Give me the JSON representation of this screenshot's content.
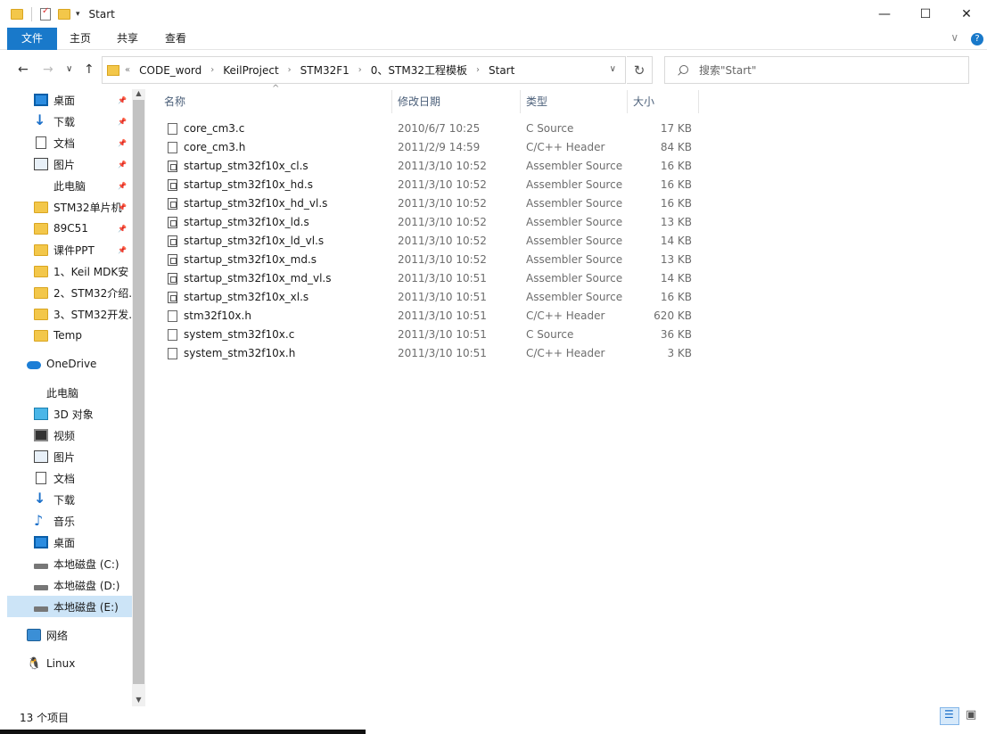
{
  "window": {
    "title": "Start",
    "controls": [
      "—",
      "☐",
      "✕"
    ]
  },
  "ribbon": {
    "tabs": [
      "文件",
      "主页",
      "共享",
      "查看"
    ],
    "expand": "∨",
    "help": "?"
  },
  "nav": {
    "back": "←",
    "forward": "→",
    "recent": "∨",
    "up": "↑",
    "overflow": "«",
    "breadcrumbs": [
      "CODE_word",
      "KeilProject",
      "STM32F1",
      "0、STM32工程模板",
      "Start"
    ],
    "dropdown": "∨",
    "refresh": "↻",
    "search_placeholder": "搜索\"Start\""
  },
  "sidebar": {
    "items": [
      {
        "label": "桌面",
        "icon": "desktop-icon",
        "pinned": true
      },
      {
        "label": "下载",
        "icon": "download-icon",
        "pinned": true
      },
      {
        "label": "文档",
        "icon": "document-icon",
        "pinned": true
      },
      {
        "label": "图片",
        "icon": "pictures-icon",
        "pinned": true
      },
      {
        "label": "此电脑",
        "icon": "",
        "pinned": true
      },
      {
        "label": "STM32单片机",
        "icon": "folder-icon",
        "pinned": true
      },
      {
        "label": "89C51",
        "icon": "folder-icon",
        "pinned": true
      },
      {
        "label": "课件PPT",
        "icon": "folder-icon",
        "pinned": true
      },
      {
        "label": "1、Keil MDK安",
        "icon": "folder-icon",
        "pinned": false
      },
      {
        "label": "2、STM32介绍.",
        "icon": "folder-icon",
        "pinned": false
      },
      {
        "label": "3、STM32开发.",
        "icon": "folder-icon",
        "pinned": false
      },
      {
        "label": "Temp",
        "icon": "folder-icon",
        "pinned": false
      },
      {
        "label": "OneDrive",
        "icon": "onedrive-icon",
        "pinned": false
      },
      {
        "label": "此电脑",
        "icon": "",
        "pinned": false
      },
      {
        "label": "3D 对象",
        "icon": "3d-objects-icon",
        "pinned": false
      },
      {
        "label": "视频",
        "icon": "video-icon",
        "pinned": false
      },
      {
        "label": "图片",
        "icon": "pictures-icon",
        "pinned": false
      },
      {
        "label": "文档",
        "icon": "document-icon",
        "pinned": false
      },
      {
        "label": "下载",
        "icon": "download-icon",
        "pinned": false
      },
      {
        "label": "音乐",
        "icon": "music-icon",
        "pinned": false
      },
      {
        "label": "桌面",
        "icon": "desktop-icon",
        "pinned": false
      },
      {
        "label": "本地磁盘 (C:)",
        "icon": "drive-icon",
        "pinned": false
      },
      {
        "label": "本地磁盘 (D:)",
        "icon": "drive-icon",
        "pinned": false
      },
      {
        "label": "本地磁盘 (E:)",
        "icon": "drive-icon",
        "pinned": false,
        "selected": true
      },
      {
        "label": "网络",
        "icon": "network-icon",
        "pinned": false
      },
      {
        "label": "Linux",
        "icon": "linux-icon",
        "pinned": false
      }
    ]
  },
  "columns": {
    "name": "名称",
    "date": "修改日期",
    "type": "类型",
    "size": "大小",
    "sort_indicator": "^"
  },
  "files": [
    {
      "name": "core_cm3.c",
      "date": "2010/6/7 10:25",
      "type": "C Source",
      "size": "17 KB",
      "icon": "c-file-icon"
    },
    {
      "name": "core_cm3.h",
      "date": "2011/2/9 14:59",
      "type": "C/C++ Header",
      "size": "84 KB",
      "icon": "h-file-icon"
    },
    {
      "name": "startup_stm32f10x_cl.s",
      "date": "2011/3/10 10:52",
      "type": "Assembler Source",
      "size": "16 KB",
      "icon": "asm-file-icon"
    },
    {
      "name": "startup_stm32f10x_hd.s",
      "date": "2011/3/10 10:52",
      "type": "Assembler Source",
      "size": "16 KB",
      "icon": "asm-file-icon"
    },
    {
      "name": "startup_stm32f10x_hd_vl.s",
      "date": "2011/3/10 10:52",
      "type": "Assembler Source",
      "size": "16 KB",
      "icon": "asm-file-icon"
    },
    {
      "name": "startup_stm32f10x_ld.s",
      "date": "2011/3/10 10:52",
      "type": "Assembler Source",
      "size": "13 KB",
      "icon": "asm-file-icon"
    },
    {
      "name": "startup_stm32f10x_ld_vl.s",
      "date": "2011/3/10 10:52",
      "type": "Assembler Source",
      "size": "14 KB",
      "icon": "asm-file-icon"
    },
    {
      "name": "startup_stm32f10x_md.s",
      "date": "2011/3/10 10:52",
      "type": "Assembler Source",
      "size": "13 KB",
      "icon": "asm-file-icon"
    },
    {
      "name": "startup_stm32f10x_md_vl.s",
      "date": "2011/3/10 10:51",
      "type": "Assembler Source",
      "size": "14 KB",
      "icon": "asm-file-icon"
    },
    {
      "name": "startup_stm32f10x_xl.s",
      "date": "2011/3/10 10:51",
      "type": "Assembler Source",
      "size": "16 KB",
      "icon": "asm-file-icon"
    },
    {
      "name": "stm32f10x.h",
      "date": "2011/3/10 10:51",
      "type": "C/C++ Header",
      "size": "620 KB",
      "icon": "h-file-icon"
    },
    {
      "name": "system_stm32f10x.c",
      "date": "2011/3/10 10:51",
      "type": "C Source",
      "size": "36 KB",
      "icon": "c-file-icon"
    },
    {
      "name": "system_stm32f10x.h",
      "date": "2011/3/10 10:51",
      "type": "C/C++ Header",
      "size": "3 KB",
      "icon": "h-file-icon"
    }
  ],
  "status": {
    "count": "13 个项目"
  },
  "colors": {
    "accent": "#1979ca",
    "selection": "#cce4f7",
    "folder": "#f3c74a",
    "column_header_text": "#4c607a",
    "secondary_text": "#6d6d6d"
  }
}
